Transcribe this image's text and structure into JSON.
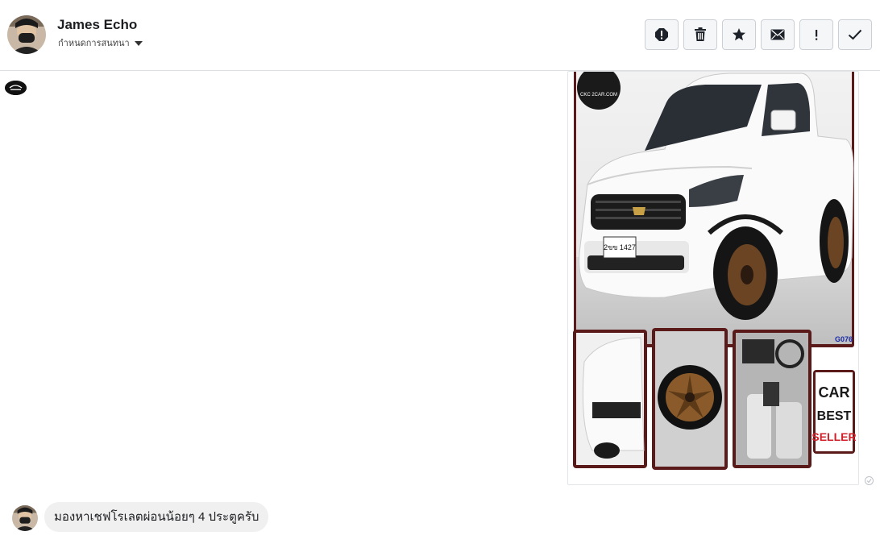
{
  "conversation": {
    "contact_name": "James Echo",
    "conversation_settings_label": "กำหนดการสนทนา",
    "avatar_icon": "profile-photo-icon"
  },
  "toolbar": {
    "buttons": [
      {
        "icon": "spam-alert-icon",
        "tooltip": ""
      },
      {
        "icon": "trash-icon",
        "tooltip": ""
      },
      {
        "icon": "star-icon",
        "tooltip": ""
      },
      {
        "icon": "envelope-icon",
        "tooltip": ""
      },
      {
        "icon": "exclamation-icon",
        "tooltip": ""
      },
      {
        "icon": "checkmark-icon",
        "tooltip": ""
      }
    ]
  },
  "messages": {
    "image_message": {
      "watermark_text": "CKC 2CAR.COM",
      "plate_text": "2ขข 1427",
      "code_text": "G076",
      "badge_lines": [
        "CAR",
        "BEST",
        "SELLER"
      ]
    },
    "incoming_text": "มองหาเชฟโรเลตผ่อนน้อยๆ 4 ประตูครับ"
  },
  "colors": {
    "header_border": "#dddfe2",
    "bubble_bg": "#f1f0f0",
    "button_bg": "#f5f6f7",
    "car_frame": "#5a1a1a",
    "wheel_bronze": "#8a5a2b",
    "seller_red": "#d0202a"
  }
}
